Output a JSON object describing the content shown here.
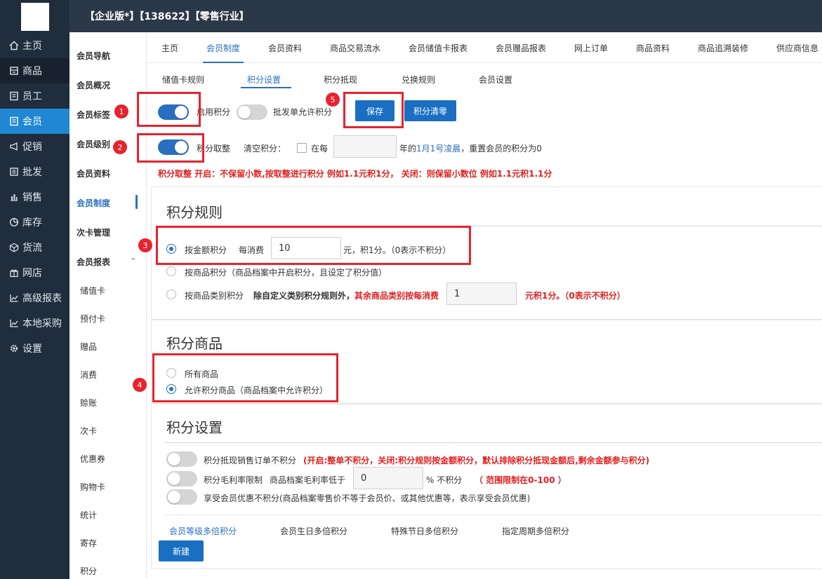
{
  "header": {
    "title": "【企业版*】【138622】【零售行业】"
  },
  "nav": [
    {
      "label": "主页",
      "icon": "home-icon"
    },
    {
      "label": "商品",
      "icon": "goods-icon"
    },
    {
      "label": "员工",
      "icon": "staff-icon"
    },
    {
      "label": "会员",
      "icon": "member-icon"
    },
    {
      "label": "促销",
      "icon": "megaphone-icon"
    },
    {
      "label": "批发",
      "icon": "wholesale-icon"
    },
    {
      "label": "销售",
      "icon": "bar-chart-icon"
    },
    {
      "label": "库存",
      "icon": "pie-chart-icon"
    },
    {
      "label": "货流",
      "icon": "cube-icon"
    },
    {
      "label": "网店",
      "icon": "gift-icon"
    },
    {
      "label": "高级报表",
      "icon": "line-chart-icon"
    },
    {
      "label": "本地采购",
      "icon": "line-chart-icon"
    },
    {
      "label": "设置",
      "icon": "gear-icon"
    }
  ],
  "subnav": {
    "items": [
      "会员导航",
      "会员概况",
      "会员标签",
      "会员级别",
      "会员资料",
      "会员制度",
      "次卡管理",
      "会员报表"
    ],
    "report_items": [
      "储值卡",
      "预付卡",
      "赠品",
      "消费",
      "赊账",
      "次卡",
      "优惠券",
      "购物卡",
      "统计",
      "寄存",
      "积分"
    ]
  },
  "tabs_top": [
    "主页",
    "会员制度",
    "会员资料",
    "商品交易流水",
    "会员储值卡报表",
    "会员赠品报表",
    "网上订单",
    "商品资料",
    "商品追溯装修",
    "供应商信息"
  ],
  "tabs_sub": [
    "储值卡规则",
    "积分设置",
    "积分抵现",
    "兑换规则",
    "会员设置"
  ],
  "top_settings": {
    "enable_points": "启用积分",
    "wholesale_points": "批发单允许积分",
    "save": "保存",
    "clear_points": "积分清零",
    "round_points": "积分取整",
    "clear_label": "清空积分：",
    "every": "在每",
    "year_pre": "年的",
    "year_link": "1月1号凌晨",
    "year_post": "，重置会员的积分为0",
    "round_note": "积分取整 开启：不保留小数,按取整进行积分 例如1.1元积1分， 关闭：则保留小数位 例如1.1元积1.1分"
  },
  "rules": {
    "title": "积分规则",
    "by_amount": "按金额积分",
    "per_spend": "每消费",
    "amount_value": "10",
    "amount_suffix": "元，积1分。（0表示不积分）",
    "by_goods": "按商品积分（商品档案中开启积分，且设定了积分值）",
    "by_category": "按商品类别积分",
    "category_note_black": "除自定义类别积分规则外，",
    "category_note_red": "其余商品类别按每消费",
    "category_value": "1",
    "category_suffix": "元积1分。（0表示不积分）"
  },
  "goods": {
    "title": "积分商品",
    "all": "所有商品",
    "allowed": "允许积分商品（商品档案中允许积分）"
  },
  "settings": {
    "title": "积分设置",
    "row1_label": "积分抵现销售订单不积分",
    "row1_note": "(开启:整单不积分，关闭:积分规则按金额积分，默认排除积分抵现金额后,剩余金额参与积分)",
    "row2_label": "积分毛利率限制",
    "row2_sub": "商品档案毛利率低于",
    "row2_value": "0",
    "row2_suffix": "% 不积分",
    "row2_note": "（ 范围限制在0-100 ）",
    "row3_label": "享受会员优惠不积分(商品档案零售价不等于会员价、或其他优惠等，表示享受会员优惠)"
  },
  "multiplier_tabs": [
    "会员等级多倍积分",
    "会员生日多倍积分",
    "特殊节日多倍积分",
    "指定周期多倍积分"
  ],
  "new_button": "新建",
  "annotations": [
    "1",
    "2",
    "3",
    "4",
    "5"
  ],
  "colors": {
    "accent": "#1a6fc2",
    "nav_bg": "#1f2d3d",
    "annotation": "#e6232e"
  }
}
